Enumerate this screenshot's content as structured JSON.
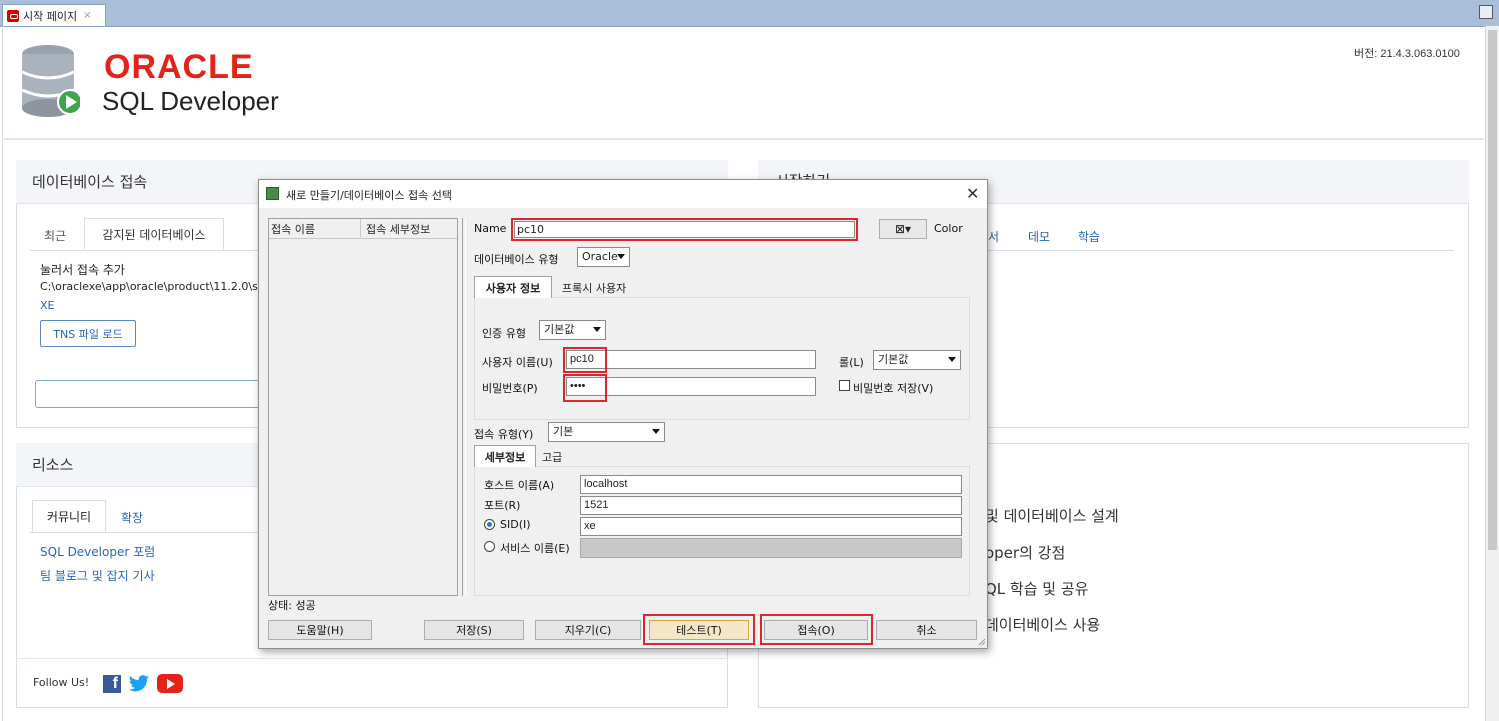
{
  "tabs": {
    "start_page": "시작 페이지",
    "close": "×"
  },
  "header": {
    "brand": "ORACLE",
    "product": "SQL Developer",
    "version": "버전: 21.4.3.063.0100"
  },
  "db_panel": {
    "title": "데이터베이스 접속",
    "tab_recent": "최근",
    "tab_detected": "감지된 데이터베이스",
    "add_label": "눌러서 접속 추가",
    "path": "C:\\oraclexe\\app\\oracle\\product\\11.2.0\\se",
    "xe": "XE",
    "tns_button": "TNS 파일 로드"
  },
  "start_panel": {
    "title_fragment": "시작하기",
    "tab_frag": "서",
    "tab_demo": "데모",
    "tab_learn": "학습"
  },
  "resources_panel": {
    "title": "리소스",
    "tab_community": "커뮤니티",
    "tab_extensions": "확장",
    "link_forum": "SQL Developer 포럼",
    "link_blog": "팀 블로그 및 잡지 기사",
    "follow": "Follow Us!"
  },
  "learn_panel": {
    "item1": "및 데이터베이스 설계",
    "item2": "oper의 강점",
    "item3": "QL 학습 및 공유",
    "item4": "데이터베이스 사용"
  },
  "dialog": {
    "title": "새로 만들기/데이터베이스 접속 선택",
    "close": "✕",
    "list_col_name": "접속 이름",
    "list_col_detail": "접속 세부정보",
    "name_label": "Name",
    "name_value": "pc10",
    "color_label": "Color",
    "db_type_label": "데이터베이스 유형",
    "db_type_value": "Oracle",
    "tab_user_info": "사용자 정보",
    "tab_proxy_user": "프록시 사용자",
    "auth_type_label": "인증 유형",
    "auth_type_value": "기본값",
    "username_label": "사용자 이름(U)",
    "username_value": "pc10",
    "role_label": "롤(L)",
    "role_value": "기본값",
    "password_label": "비밀번호(P)",
    "password_value": "••••",
    "save_password_label": "비밀번호 저장(V)",
    "conn_type_label": "접속 유형(Y)",
    "conn_type_value": "기본",
    "tab_details": "세부정보",
    "tab_advanced": "고급",
    "host_label": "호스트 이름(A)",
    "host_value": "localhost",
    "port_label": "포트(R)",
    "port_value": "1521",
    "sid_label": "SID(I)",
    "sid_value": "xe",
    "service_label": "서비스 이름(E)",
    "status": "상태: 성공",
    "btn_help": "도움말(H)",
    "btn_save": "저장(S)",
    "btn_clear": "지우기(C)",
    "btn_test": "테스트(T)",
    "btn_connect": "접속(O)",
    "btn_cancel": "취소"
  },
  "colors": {
    "oracle_red": "#e2231a",
    "link_blue": "#2a64b4",
    "highlight_red": "#d8282f"
  }
}
